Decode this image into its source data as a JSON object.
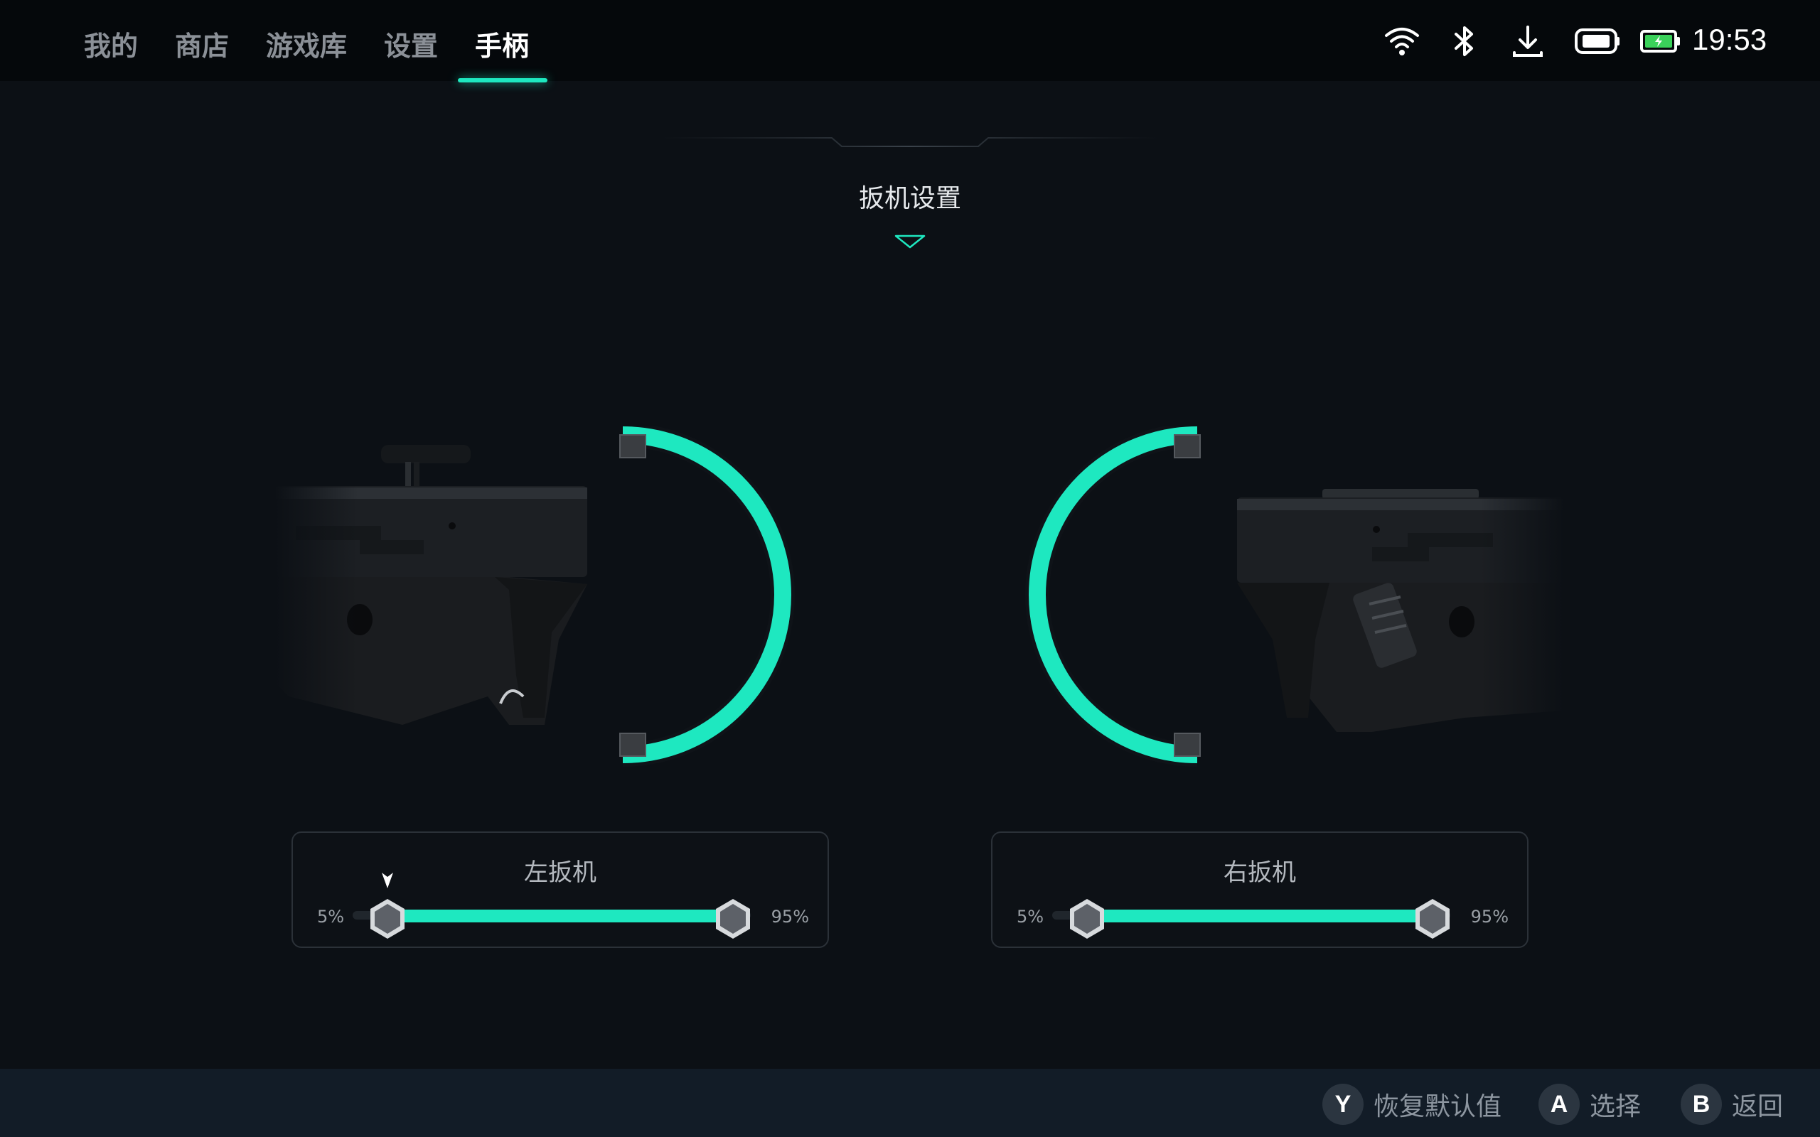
{
  "tabs": [
    {
      "label": "我的",
      "active": false
    },
    {
      "label": "商店",
      "active": false
    },
    {
      "label": "游戏库",
      "active": false
    },
    {
      "label": "设置",
      "active": false
    },
    {
      "label": "手柄",
      "active": true
    }
  ],
  "status": {
    "icons": [
      "wifi-icon",
      "bluetooth-icon",
      "download-icon",
      "controller-battery-icon",
      "battery-charging-icon"
    ],
    "time": "19:53"
  },
  "section": {
    "title": "扳机设置"
  },
  "triggers": {
    "left": {
      "title": "左扳机",
      "min_label": "5%",
      "max_label": "95%",
      "range_start": 5,
      "range_end": 95
    },
    "right": {
      "title": "右扳机",
      "min_label": "5%",
      "max_label": "95%",
      "range_start": 5,
      "range_end": 95
    }
  },
  "hints": [
    {
      "key": "Y",
      "label": "恢复默认值"
    },
    {
      "key": "A",
      "label": "选择"
    },
    {
      "key": "B",
      "label": "返回"
    }
  ],
  "colors": {
    "accent": "#1ee8c0",
    "background": "#0c1015",
    "topbar": "#05080b",
    "bottombar": "#121c27"
  }
}
